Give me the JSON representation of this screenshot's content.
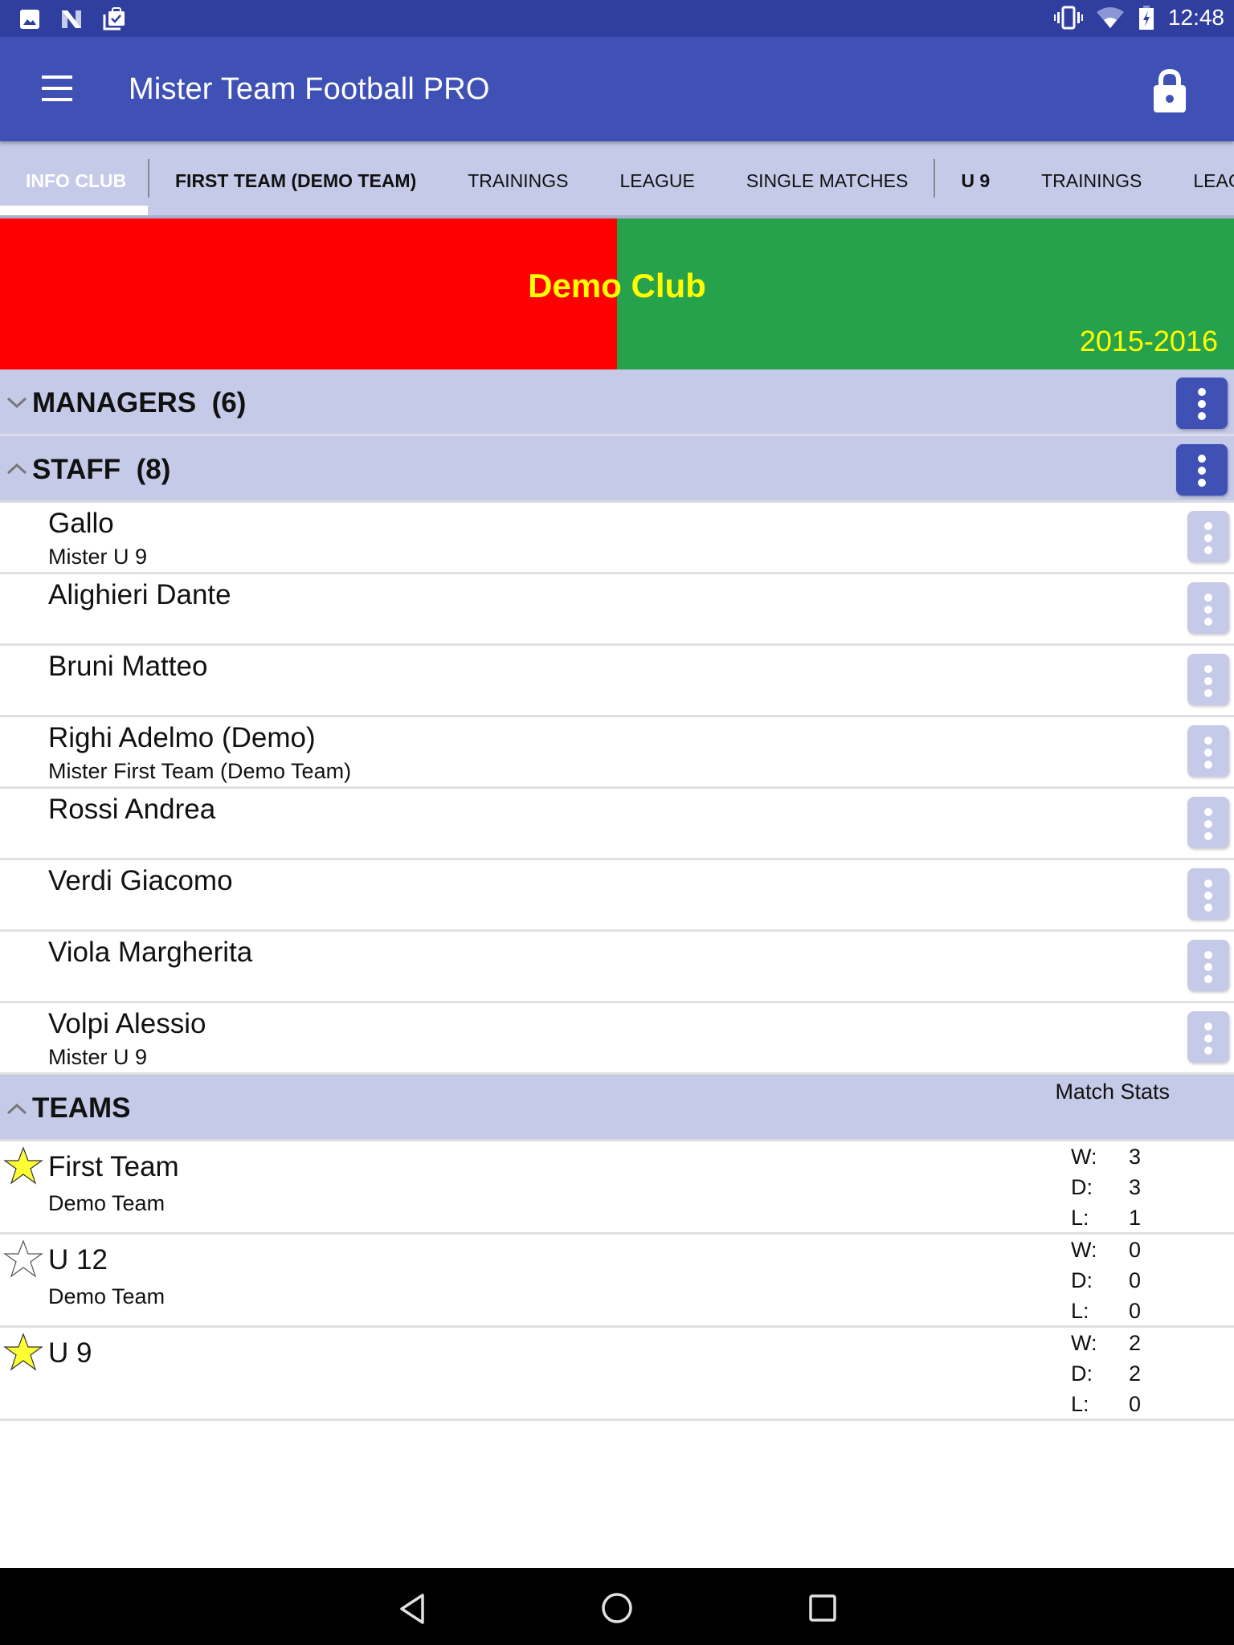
{
  "status_bar": {
    "left_icons": [
      "image-icon",
      "n-logo-icon",
      "task-check-icon"
    ],
    "right_icons": [
      "vibrate-icon",
      "wifi-icon",
      "battery-charging-icon"
    ],
    "time": "12:48"
  },
  "app_bar": {
    "title": "Mister Team Football PRO",
    "menu_icon": "hamburger-menu-icon",
    "action_icon": "lock-icon"
  },
  "tabs": [
    {
      "label": "INFO CLUB",
      "active": true,
      "bold": true
    },
    {
      "label": "FIRST TEAM (DEMO TEAM)",
      "active": false,
      "bold": true
    },
    {
      "label": "TRAININGS",
      "active": false,
      "bold": false
    },
    {
      "label": "LEAGUE",
      "active": false,
      "bold": false
    },
    {
      "label": "SINGLE MATCHES",
      "active": false,
      "bold": false
    },
    {
      "label": "U 9",
      "active": false,
      "bold": true
    },
    {
      "label": "TRAININGS",
      "active": false,
      "bold": false
    },
    {
      "label": "LEAGUE",
      "active": false,
      "bold": false
    }
  ],
  "club": {
    "name": "Demo Club",
    "season": "2015-2016",
    "colors": {
      "primary": "#ff0000",
      "secondary": "#26a14c",
      "text": "#ffff00"
    }
  },
  "sections": {
    "managers": {
      "title": "MANAGERS",
      "count": "(6)",
      "expanded": false
    },
    "staff": {
      "title": "STAFF",
      "count": "(8)",
      "expanded": true
    },
    "teams": {
      "title": "TEAMS",
      "expanded": true,
      "stats_label": "Match Stats"
    }
  },
  "staff": [
    {
      "name": "Gallo",
      "role": "Mister U 9"
    },
    {
      "name": "Alighieri Dante",
      "role": ""
    },
    {
      "name": "Bruni Matteo",
      "role": ""
    },
    {
      "name": "Righi Adelmo (Demo)",
      "role": "Mister First Team (Demo Team)"
    },
    {
      "name": "Rossi Andrea",
      "role": ""
    },
    {
      "name": "Verdi Giacomo",
      "role": ""
    },
    {
      "name": "Viola Margherita",
      "role": ""
    },
    {
      "name": "Volpi Alessio",
      "role": "Mister U 9"
    }
  ],
  "teams": [
    {
      "name": "First Team",
      "subtitle": "Demo Team",
      "favorite": true,
      "stats": {
        "W": "3",
        "D": "3",
        "L": "1"
      }
    },
    {
      "name": "U 12",
      "subtitle": "Demo Team",
      "favorite": false,
      "stats": {
        "W": "0",
        "D": "0",
        "L": "0"
      }
    },
    {
      "name": "U 9",
      "subtitle": "",
      "favorite": true,
      "stats": {
        "W": "2",
        "D": "2",
        "L": "0"
      }
    }
  ],
  "stat_labels": {
    "W": "W:",
    "D": "D:",
    "L": "L:"
  },
  "theme": {
    "primary": "#3f51b5",
    "primary_dark": "#303f9f",
    "light": "#c5cae9"
  },
  "nav_bar": {
    "buttons": [
      "back-icon",
      "home-icon",
      "recents-icon"
    ]
  }
}
